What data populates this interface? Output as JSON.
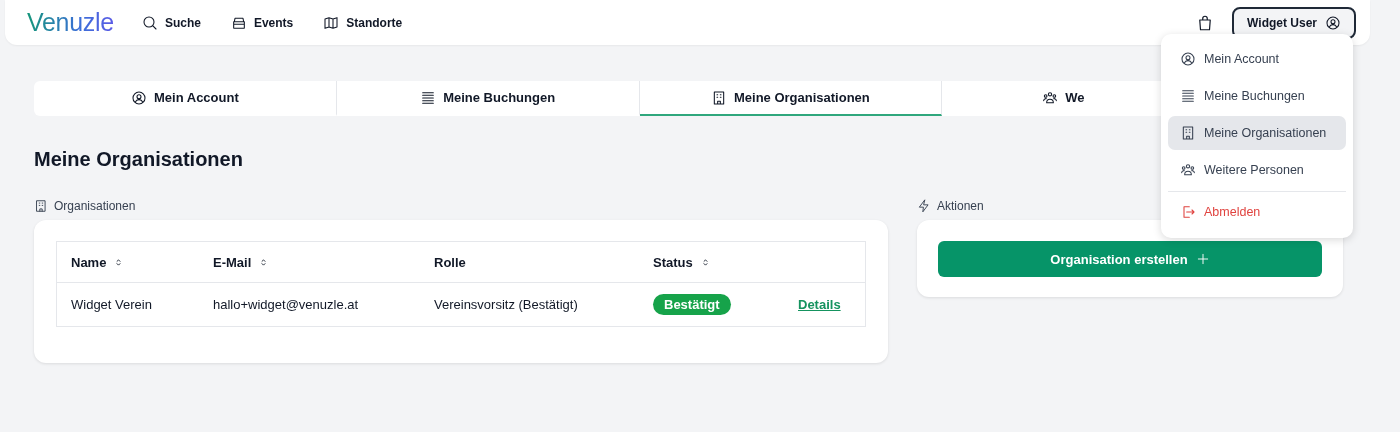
{
  "header": {
    "logo": "Venuzle",
    "nav": [
      {
        "label": "Suche"
      },
      {
        "label": "Events"
      },
      {
        "label": "Standorte"
      }
    ],
    "user_button": "Widget User"
  },
  "tabs": [
    {
      "label": "Mein Account",
      "selected": false
    },
    {
      "label": "Meine Buchungen",
      "selected": false
    },
    {
      "label": "Meine Organisationen",
      "selected": true
    },
    {
      "label": "We",
      "selected": false
    }
  ],
  "page_title": "Meine Organisationen",
  "organizations": {
    "label": "Organisationen",
    "columns": [
      {
        "label": "Name",
        "sortable": true
      },
      {
        "label": "E-Mail",
        "sortable": true
      },
      {
        "label": "Rolle",
        "sortable": false
      },
      {
        "label": "Status",
        "sortable": true
      }
    ],
    "rows": [
      {
        "name": "Widget Verein",
        "email": "hallo+widget@venuzle.at",
        "role": "Vereinsvorsitz (Bestätigt)",
        "status": "Bestätigt",
        "action": "Details"
      }
    ]
  },
  "actions": {
    "label": "Aktionen",
    "button": "Organisation erstellen"
  },
  "user_menu": {
    "items": [
      {
        "label": "Mein Account",
        "kind": "link",
        "selected": false
      },
      {
        "label": "Meine Buchungen",
        "kind": "link",
        "selected": false
      },
      {
        "label": "Meine Organisationen",
        "kind": "link",
        "selected": true
      },
      {
        "label": "Weitere Personen",
        "kind": "link",
        "selected": false
      },
      {
        "label": "Abmelden",
        "kind": "danger",
        "selected": false
      }
    ]
  }
}
